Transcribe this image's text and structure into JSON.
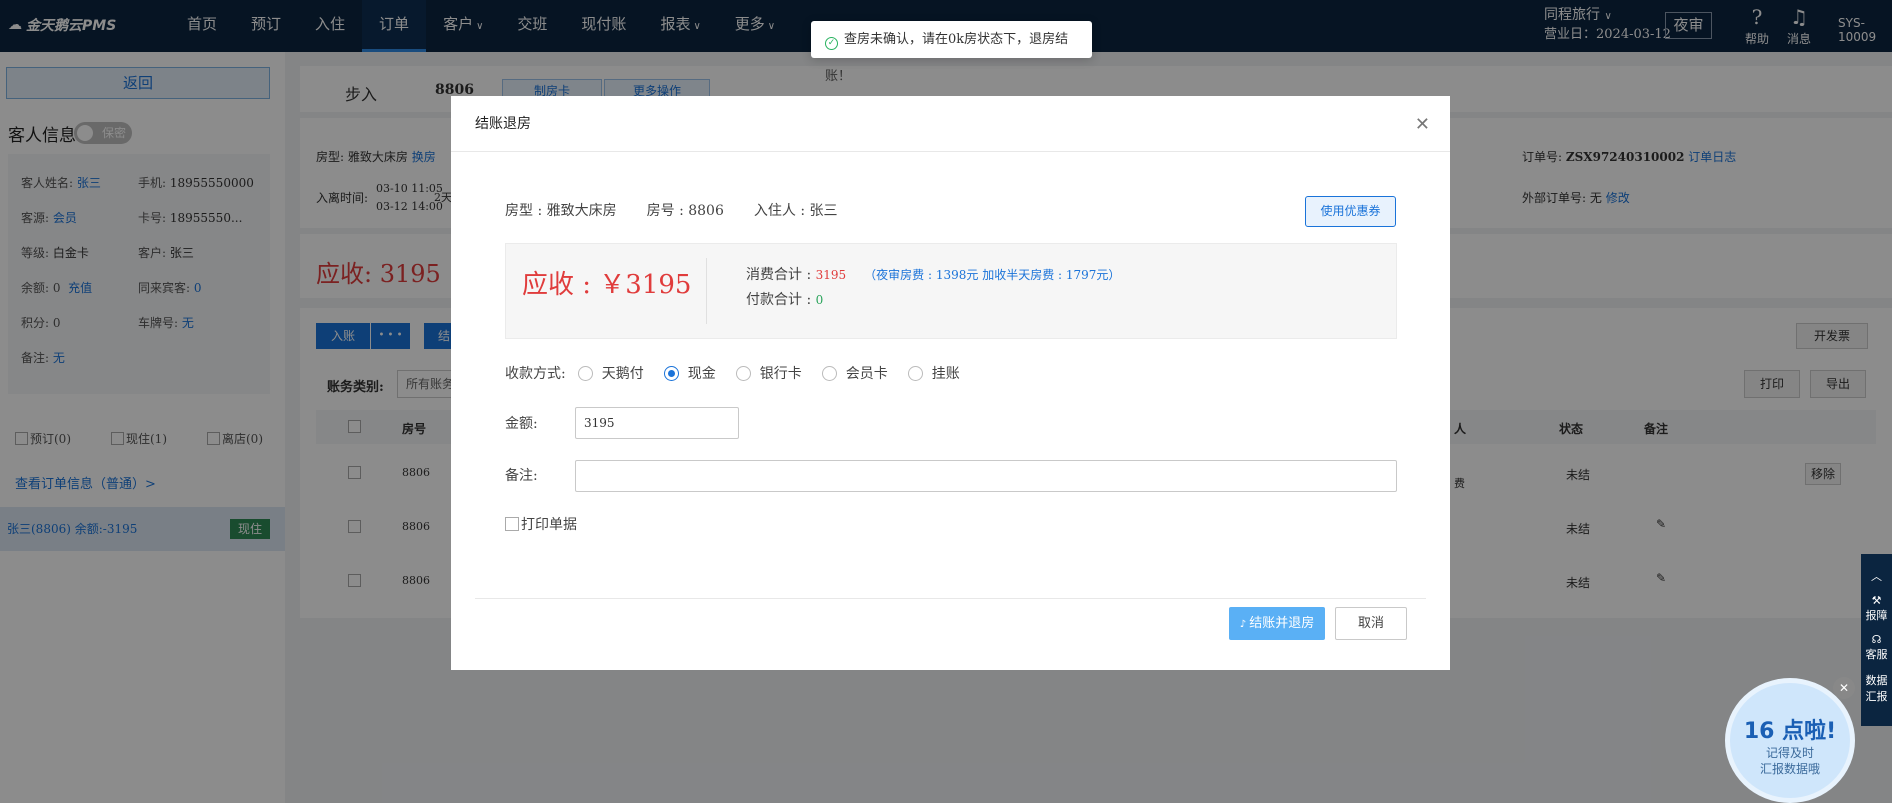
{
  "app": {
    "logo": "金天鹅云PMS"
  },
  "nav": [
    {
      "label": "首页"
    },
    {
      "label": "预订"
    },
    {
      "label": "入住"
    },
    {
      "label": "订单"
    },
    {
      "label": "客户"
    },
    {
      "label": "交班"
    },
    {
      "label": "现付账"
    },
    {
      "label": "报表"
    },
    {
      "label": "更多"
    }
  ],
  "header": {
    "hotel": "同程旅行",
    "business_date": "营业日：2024-03-12",
    "night_audit": "夜审",
    "help": "帮助",
    "messages": "消息",
    "user": "SYS-10009"
  },
  "toast": {
    "text": "查房未确认，请在0k房状态下，退房结账！"
  },
  "left": {
    "back": "返回",
    "customer_info": "客人信息",
    "privacy": "保密",
    "fields": {
      "name_label": "客人姓名:",
      "name": "张三",
      "phone_label": "手机:",
      "phone": "18955550000",
      "source_label": "客源:",
      "source": "会员",
      "card_label": "卡号:",
      "card": "18955550...",
      "level_label": "等级:",
      "level": "白金卡",
      "client_label": "客户:",
      "client": "张三",
      "balance_label": "余额: 0",
      "recharge": "充值",
      "companions_label": "同来宾客:",
      "companions": "0",
      "points_label": "积分: 0",
      "plate_label": "车牌号:",
      "plate": "无",
      "remark_label": "备注:",
      "remark": "无"
    },
    "filters": [
      "预订(0)",
      "现住(1)",
      "离店(0)"
    ],
    "view_order": "查看订单信息（普通）>",
    "guest_row": "张三(8806)   余额:-3195",
    "guest_status": "现住"
  },
  "main": {
    "checkin_type": "步入",
    "room": "8806",
    "make_card": "制房卡",
    "more_ops": "更多操作",
    "room_type_label": "房型:",
    "room_type": "雅致大床房",
    "change_room": "换房",
    "stay_label": "入离时间:",
    "stay_in": "03-10 11:05",
    "stay_out": "03-12 14:00",
    "nights": "2天",
    "order_no_label": "订单号:",
    "order_no": "ZSX97240310002",
    "order_log": "订单日志",
    "ext_order_label": "外部订单号:",
    "ext_order": "无",
    "modify": "修改",
    "due_big": "应收: 3195",
    "post": "入账",
    "post_more": "• • •",
    "settle_short": "结",
    "invoice": "开发票",
    "category_label": "账务类别:",
    "category_value": "所有账务",
    "print": "打印",
    "export": "导出",
    "columns": [
      "房号",
      "人",
      "状态",
      "备注"
    ],
    "rows": [
      {
        "room": "8806",
        "state": "未结",
        "extra": "费",
        "action": "移除"
      },
      {
        "room": "8806",
        "state": "未结"
      },
      {
        "room": "8806",
        "state": "未结"
      }
    ]
  },
  "modal": {
    "title": "结账退房",
    "room_type": "房型 : 雅致大床房",
    "room_no": "房号 : 8806",
    "guest": "入住人 : 张三",
    "coupon": "使用优惠券",
    "due": "应收 : ￥3195",
    "consume_label": "消费合计 : ",
    "consume_value": "3195",
    "consume_detail": "（夜审房费 : 1398元  加收半天房费 : 1797元）",
    "paid_label": "付款合计 : ",
    "paid_value": "0",
    "payment_label": "收款方式:",
    "payment_options": [
      "天鹅付",
      "现金",
      "银行卡",
      "会员卡",
      "挂账"
    ],
    "payment_selected": "现金",
    "amount_label": "金额:",
    "amount_value": "3195",
    "remark_label": "备注:",
    "remark_value": "",
    "print_receipt": "打印单据",
    "confirm": "结账并退房",
    "cancel": "取消"
  },
  "sidepanel": {
    "items": [
      "报障",
      "客服",
      "数据汇报"
    ]
  },
  "promo": {
    "title": "16 点啦!",
    "line1": "记得及时",
    "line2": "汇报数据哦"
  },
  "colors": {
    "nav_bg": "#0b2540",
    "accent": "#1a73d9",
    "due_red": "#e03c3c",
    "confirm_btn": "#5ab0f5"
  }
}
